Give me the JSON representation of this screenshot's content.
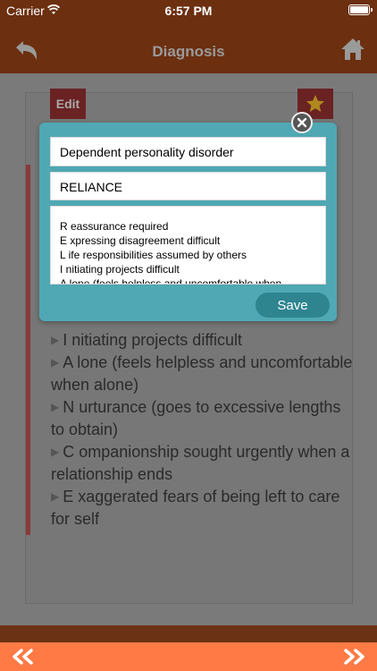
{
  "status_bar": {
    "carrier": "Carrier",
    "time": "6:57 PM"
  },
  "nav": {
    "title": "Diagnosis"
  },
  "card": {
    "edit_label": "Edit",
    "items": [
      "I nitiating projects difficult",
      "A lone (feels helpless and uncomfortable when alone)",
      "N urturance (goes to excessive lengths to obtain)",
      "C ompanionship sought urgently when a relationship ends",
      "E xaggerated fears of being left to care for self"
    ]
  },
  "modal": {
    "title_value": "Dependent personality disorder",
    "mnemonic_value": "RELIANCE",
    "text_lines": [
      "R eassurance required",
      " E xpressing disagreement difficult",
      " L ife responsibilities assumed by others",
      " I nitiating projects difficult",
      " A lone (feels helpless and uncomfortable when"
    ],
    "save_label": "Save"
  },
  "colors": {
    "nav_bg": "#6c2f10",
    "modal_bg": "#4fa8b3",
    "save_bg": "#2e8590",
    "bottom_bar": "#ff7a45"
  },
  "icons": {
    "back": "back-arrow-icon",
    "home": "home-icon",
    "favorite": "star-icon",
    "close": "close-icon",
    "prev": "double-chevron-left-icon",
    "next": "double-chevron-right-icon"
  }
}
